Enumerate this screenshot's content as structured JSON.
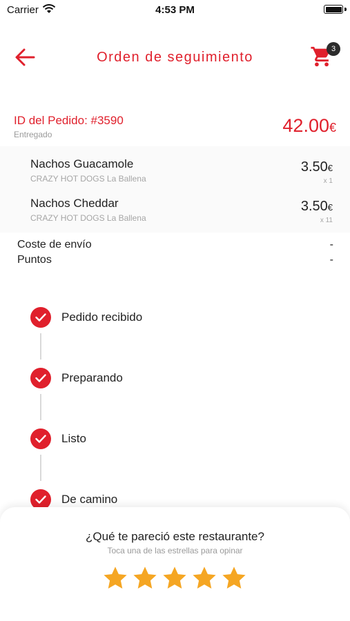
{
  "status_bar": {
    "carrier": "Carrier",
    "time": "4:53 PM"
  },
  "nav": {
    "title": "Orden de seguimiento",
    "cart_count": "3",
    "accent": "#e0202c"
  },
  "order": {
    "id_label": "ID del Pedido: #3590",
    "status": "Entregado",
    "total": "42.00",
    "currency": "€"
  },
  "items": [
    {
      "name": "Nachos Guacamole",
      "restaurant": "CRAZY HOT DOGS La Ballena",
      "price": "3.50",
      "currency": "€",
      "qty": "x 1"
    },
    {
      "name": "Nachos Cheddar",
      "restaurant": "CRAZY HOT DOGS La Ballena",
      "price": "3.50",
      "currency": "€",
      "qty": "x 11"
    }
  ],
  "fees": [
    {
      "label": "Coste de envío",
      "value": "-"
    },
    {
      "label": "Puntos",
      "value": "-"
    }
  ],
  "timeline": [
    {
      "label": "Pedido recibido",
      "icon": "check-icon"
    },
    {
      "label": "Preparando",
      "icon": "check-icon"
    },
    {
      "label": "Listo",
      "icon": "check-icon"
    },
    {
      "label": "De camino",
      "icon": "check-icon"
    }
  ],
  "rating": {
    "question": "¿Qué te pareció este restaurante?",
    "hint": "Toca una de las estrellas para opinar",
    "stars": 5,
    "star_color": "#f5a623"
  }
}
